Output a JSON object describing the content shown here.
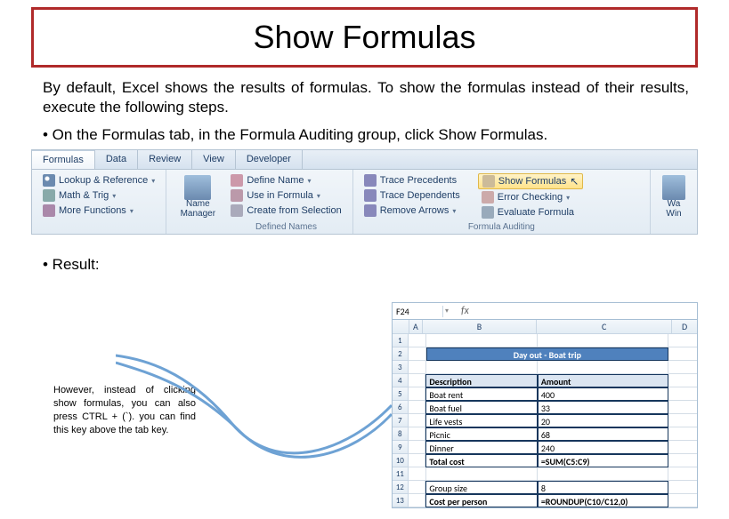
{
  "title": "Show Formulas",
  "intro": "By default, Excel shows the results of formulas. To show the formulas instead of their results, execute the following steps.",
  "step1": "• On the Formulas tab, in the Formula Auditing group, click Show Formulas.",
  "ribbon": {
    "tabs": [
      "Formulas",
      "Data",
      "Review",
      "View",
      "Developer"
    ],
    "funclib": {
      "lookup": "Lookup & Reference",
      "math": "Math & Trig",
      "more": "More Functions",
      "name_mgr": "Name Manager",
      "group_title": ""
    },
    "names": {
      "define": "Define Name",
      "use": "Use in Formula",
      "create": "Create from Selection",
      "group_title": "Defined Names"
    },
    "audit": {
      "precedents": "Trace Precedents",
      "dependents": "Trace Dependents",
      "remove": "Remove Arrows",
      "show": "Show Formulas",
      "error": "Error Checking",
      "evaluate": "Evaluate Formula",
      "group_title": "Formula Auditing"
    },
    "watch": {
      "label": "Watch Window"
    }
  },
  "result_label": "• Result:",
  "tip": "However, instead of clicking show formulas, you can also press CTRL + (`). you can find this key above the tab key.",
  "sheet": {
    "namebox": "F24",
    "cols": [
      "A",
      "B",
      "C",
      "D"
    ],
    "rownums": [
      "1",
      "2",
      "3",
      "4",
      "5",
      "6",
      "7",
      "8",
      "9",
      "10",
      "11",
      "12",
      "13"
    ],
    "merged_title": "Day out - Boat trip",
    "hdr_desc": "Description",
    "hdr_amt": "Amount",
    "rows": [
      {
        "b": "Boat rent",
        "c": "400"
      },
      {
        "b": "Boat fuel",
        "c": "33"
      },
      {
        "b": "Life vests",
        "c": "20"
      },
      {
        "b": "Picnic",
        "c": "68"
      },
      {
        "b": "Dinner",
        "c": "240"
      }
    ],
    "total_label": "Total cost",
    "total_formula": "=SUM(C5:C9)",
    "group_label": "Group size",
    "group_val": "8",
    "cpp_label": "Cost per person",
    "cpp_formula": "=ROUNDUP(C10/C12,0)"
  }
}
